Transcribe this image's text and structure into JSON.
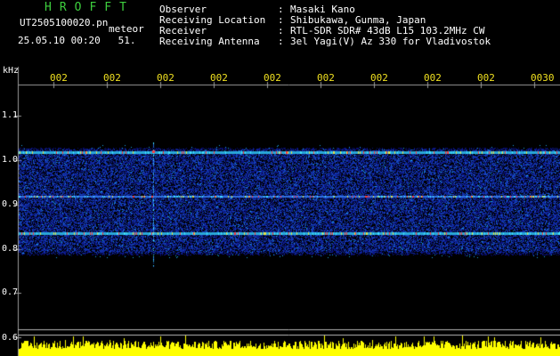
{
  "header": {
    "title": "HROFFT",
    "filename": "UT2505100020.pn",
    "mode": "meteor",
    "datetime": "25.05.10 00:20   51.",
    "info": [
      {
        "label": "Observer",
        "value": "Masaki Kano"
      },
      {
        "label": "Receiving Location",
        "value": "Shibukawa, Gunma, Japan"
      },
      {
        "label": "Receiver",
        "value": "RTL-SDR SDR# 43dB L15 103.2MHz CW"
      },
      {
        "label": "Receiving Antenna",
        "value": "3el Yagi(V) Az 330 for Vladivostok"
      }
    ],
    "separator": ":"
  },
  "axis": {
    "unit": "kHz",
    "time_ticks": [
      "002",
      "002",
      "002",
      "002",
      "002",
      "002",
      "002",
      "002",
      "002",
      "0030"
    ],
    "freq_ticks": [
      "1.1",
      "1.0",
      "0.9",
      "0.8",
      "0.7",
      "0.6"
    ]
  },
  "colors": {
    "background": "#000000",
    "title": "#3ecf3e",
    "ticks": "#f0e020",
    "grid": "#b0b0b0",
    "signal_low": "#0a1ea0",
    "signal_high": "#ff3030",
    "amplitude": "#ffff00"
  }
}
